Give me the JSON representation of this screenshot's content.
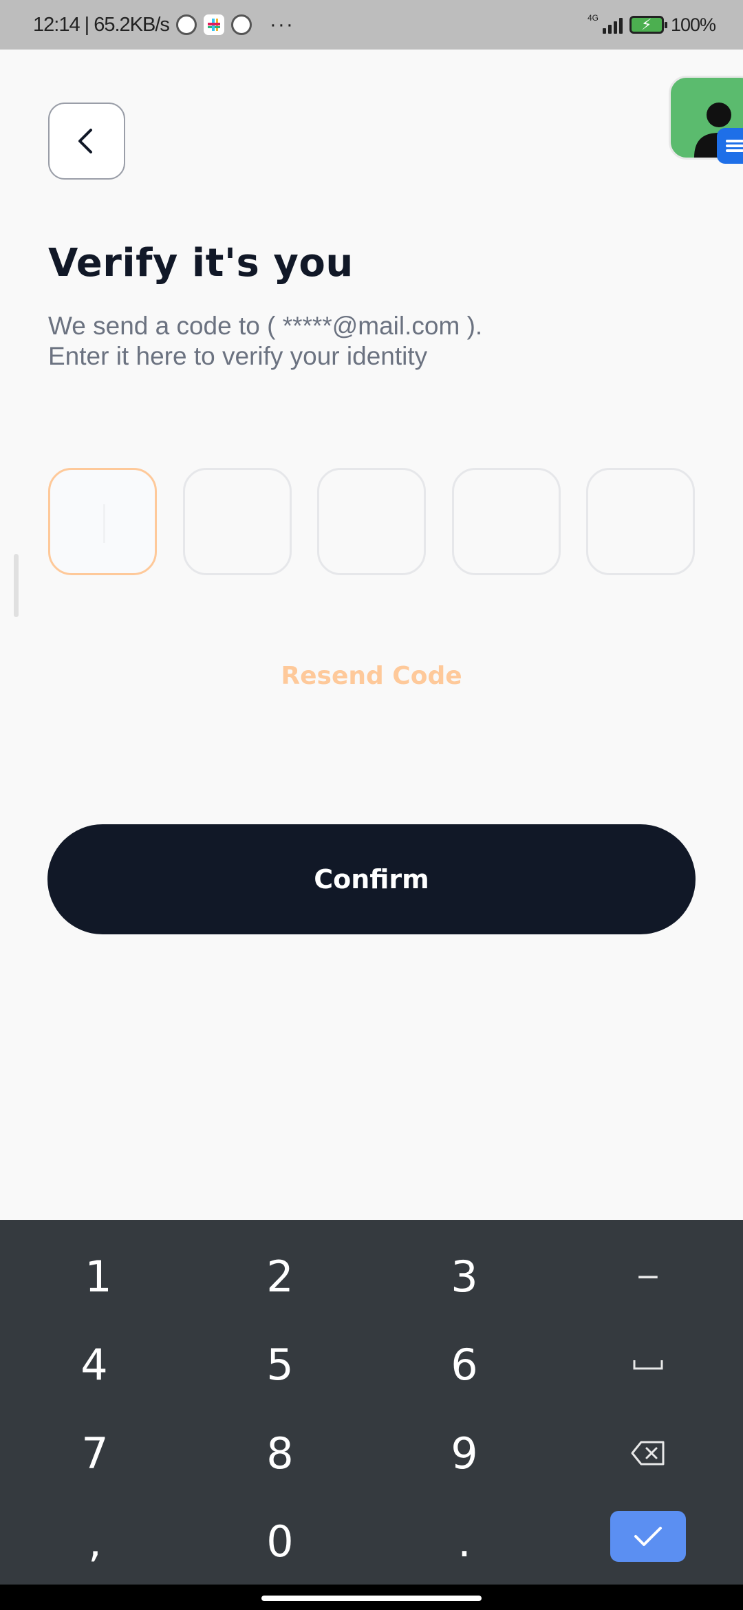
{
  "status_bar": {
    "time_speed": "12:14 | 65.2KB/s",
    "more": "···",
    "network": "4G",
    "battery": "100%",
    "icons": [
      "telegram-icon",
      "slack-icon",
      "telegram-icon",
      "signal-icon",
      "battery-charging-icon"
    ]
  },
  "header": {
    "back_icon": "chevron-left-icon",
    "title": "Verify it's you",
    "subtitle_line1": "We send a code to ( *****@mail.com ).",
    "subtitle_line2": "Enter it here to verify your identity"
  },
  "otp": {
    "digits": [
      "",
      "",
      "",
      "",
      ""
    ],
    "active_index": 0
  },
  "resend_label": "Resend Code",
  "confirm_label": "Confirm",
  "keyboard": {
    "rows": [
      [
        "1",
        "2",
        "3",
        "−"
      ],
      [
        "4",
        "5",
        "6",
        "␣"
      ],
      [
        "7",
        "8",
        "9",
        "backspace"
      ],
      [
        ",",
        "0",
        ".",
        "done"
      ]
    ],
    "icons": [
      "space-icon",
      "backspace-icon",
      "check-icon"
    ]
  },
  "colors": {
    "accent": "#fec99a",
    "primary_dark": "#111827",
    "keyboard_bg": "#353a3f",
    "done_key": "#5b8ff2",
    "subtitle": "#6b7280"
  }
}
